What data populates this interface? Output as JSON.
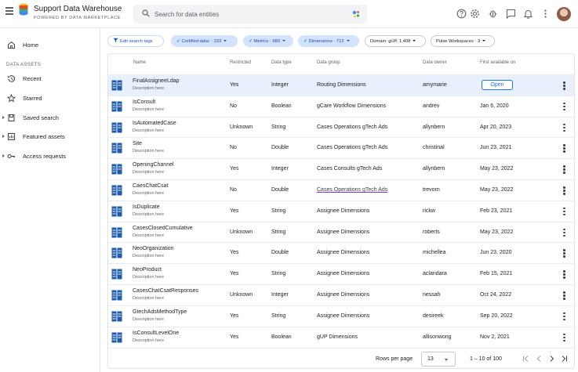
{
  "header": {
    "app_title": "Support Data Warehouse",
    "app_subtitle": "POWERED BY DATA MARKETPLACE",
    "search_placeholder": "Search for data entities"
  },
  "sidebar": {
    "section_label": "DATA ASSETS",
    "items": [
      {
        "label": "Home",
        "icon": "home-icon"
      },
      {
        "label": "Recent",
        "icon": "history-icon"
      },
      {
        "label": "Starred",
        "icon": "star-icon"
      },
      {
        "label": "Saved search",
        "icon": "saved-search-icon"
      },
      {
        "label": "Featured assets",
        "icon": "featured-icon"
      },
      {
        "label": "Access requests",
        "icon": "key-icon"
      }
    ]
  },
  "filters": {
    "edit_label": "Edit search tags",
    "chips": [
      {
        "label": "✓ Certified data: · 233"
      },
      {
        "label": "✓ Metrics · 980"
      },
      {
        "label": "✓ Dimensions · 712"
      },
      {
        "label": "Domain: gUP, 1,408"
      },
      {
        "label": "Pulse Workspaces · 3"
      }
    ]
  },
  "table": {
    "columns": [
      "Name",
      "Restricted",
      "Data type",
      "Data group",
      "Data owner",
      "First available on"
    ],
    "description_placeholder": "Description here",
    "open_label": "Open",
    "rows": [
      {
        "name": "FinalAssigneeLdap",
        "restricted": "Yes",
        "type": "Integer",
        "group": "Routing Dimensions",
        "owner": "amymarie",
        "date": ""
      },
      {
        "name": "IsConsult",
        "restricted": "No",
        "type": "Boolean",
        "group": "gCare Workflow Dimensions",
        "owner": "andrev",
        "date": "Jan 6, 2020"
      },
      {
        "name": "IsAutomatedCase",
        "restricted": "Unknown",
        "type": "String",
        "group": "Cases Operations gTech Ads",
        "owner": "allynbern",
        "date": "Apr 20, 2023"
      },
      {
        "name": "Site",
        "restricted": "No",
        "type": "Double",
        "group": "Cases Operations gTech Ads",
        "owner": "christinal",
        "date": "Jun 23, 2021"
      },
      {
        "name": "OpeningChannel",
        "restricted": "Yes",
        "type": "Integer",
        "group": "Cases Consults gTech Ads",
        "owner": "allynbern",
        "date": "May 23, 2022"
      },
      {
        "name": "CaesChatCsat",
        "restricted": "No",
        "type": "Double",
        "group": "Cases Operations gTech Ads",
        "owner": "trevorn",
        "date": "May 23, 2022"
      },
      {
        "name": "IsDuplicate",
        "restricted": "Yes",
        "type": "String",
        "group": "Assignee Dimensions",
        "owner": "rickw",
        "date": "Feb 23, 2021"
      },
      {
        "name": "CasesClosedCumulative",
        "restricted": "Unknown",
        "type": "String",
        "group": "Assignee Dimensions",
        "owner": "roberts",
        "date": "May 23, 2022"
      },
      {
        "name": "NeoOrganization",
        "restricted": "Yes",
        "type": "Double",
        "group": "Assignee Dimensions",
        "owner": "michellea",
        "date": "Jun 23, 2020"
      },
      {
        "name": "NeoProduct",
        "restricted": "Yes",
        "type": "String",
        "group": "Assignee Dimensions",
        "owner": "aclandara",
        "date": "Feb 15, 2021"
      },
      {
        "name": "CasesChatCsatResponses",
        "restricted": "Unknown",
        "type": "Integer",
        "group": "Assignee Dimensions",
        "owner": "nessah",
        "date": "Oct 24, 2022"
      },
      {
        "name": "GtechAdsMethodType",
        "restricted": "Yes",
        "type": "String",
        "group": "Assignee Dimensions",
        "owner": "desireek",
        "date": "Sep 20, 2022"
      },
      {
        "name": "IsConsultLevelOne",
        "restricted": "Yes",
        "type": "Boolean",
        "group": "gUP Dimensions",
        "owner": "allisonwong",
        "date": "Nov 2, 2021"
      }
    ]
  },
  "pagination": {
    "rows_per_page_label": "Rows per page",
    "rows_per_page_value": "13",
    "range_label": "1 – 10 of 100"
  },
  "colors": {
    "accent": "#1a73e8",
    "selected_row": "#e8f0fe",
    "chip_blue": "#d3e3fd",
    "entity_icon": "#1e5ba8"
  }
}
